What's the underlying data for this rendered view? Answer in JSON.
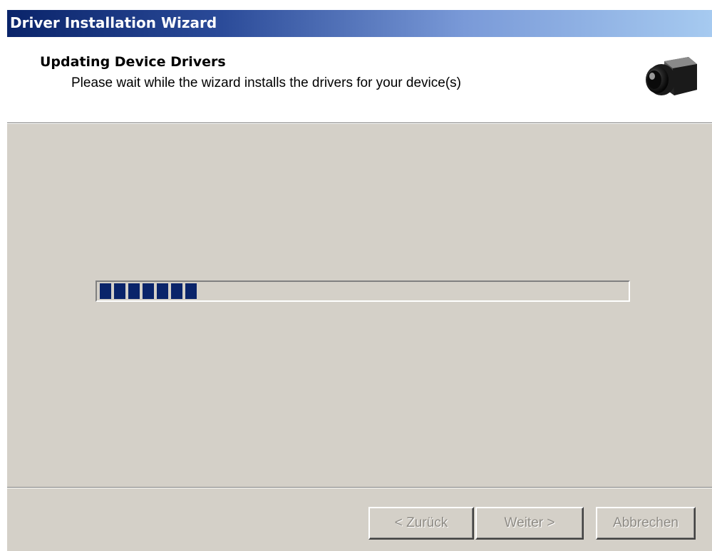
{
  "window": {
    "title": "Driver Installation Wizard"
  },
  "header": {
    "title": "Updating Device Drivers",
    "subtitle": "Please wait while the wizard installs the drivers for your device(s)",
    "icon": "camera-icon"
  },
  "progress": {
    "filled_blocks": 7,
    "color": "#0a246a"
  },
  "buttons": {
    "back_label": "< Zurück",
    "next_label": "Weiter >",
    "cancel_label": "Abbrechen"
  },
  "colors": {
    "titlebar_start": "#0a246a",
    "titlebar_end": "#a6caf0",
    "dialog_face": "#d4d0c8",
    "disabled_text": "#8e8b85"
  }
}
